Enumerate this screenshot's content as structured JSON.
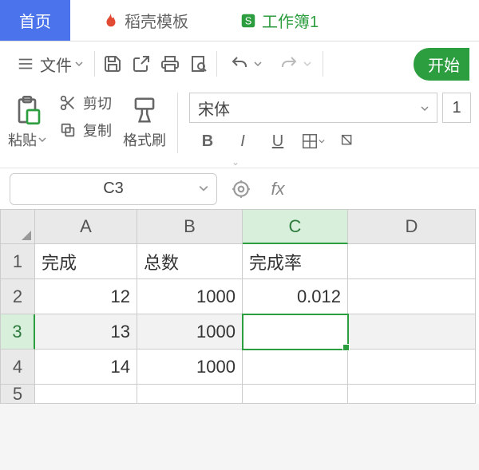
{
  "tabs": {
    "home": "首页",
    "dao": "稻壳模板",
    "wb": "工作簿1"
  },
  "toolbar": {
    "file": "文件",
    "start": "开始"
  },
  "ribbon": {
    "paste": "粘贴",
    "cut": "剪切",
    "copy": "复制",
    "format_painter": "格式刷",
    "font_name": "宋体",
    "font_size": "1",
    "bold": "B",
    "italic": "I",
    "underline": "U"
  },
  "namebox": "C3",
  "fx_label": "fx",
  "columns": [
    "A",
    "B",
    "C",
    "D"
  ],
  "rows": [
    "1",
    "2",
    "3",
    "4",
    "5"
  ],
  "headers": {
    "A": "完成",
    "B": "总数",
    "C": "完成率"
  },
  "data": {
    "r2": {
      "A": "12",
      "B": "1000",
      "C": "0.012"
    },
    "r3": {
      "A": "13",
      "B": "1000"
    },
    "r4": {
      "A": "14",
      "B": "1000"
    }
  },
  "chart_data": {
    "type": "table",
    "columns": [
      "完成",
      "总数",
      "完成率"
    ],
    "rows": [
      [
        12,
        1000,
        0.012
      ],
      [
        13,
        1000,
        null
      ],
      [
        14,
        1000,
        null
      ]
    ]
  }
}
